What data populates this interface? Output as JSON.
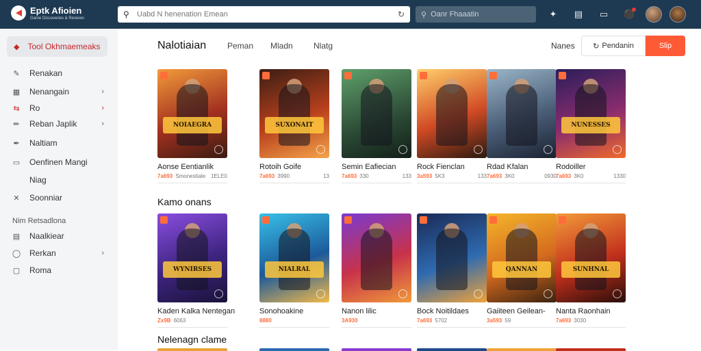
{
  "app": {
    "title": "Eptk Afioien",
    "subtitle": "Game Discoveries & Reviews"
  },
  "search": {
    "placeholder": "Uabd N henenation Emean"
  },
  "search2": {
    "placeholder": "Oanr Fhaaatin"
  },
  "sidebar": {
    "active": "Tool Okhmaemeaks",
    "items": [
      {
        "label": "Renakan",
        "icon": "pencil-icon",
        "chevron": false
      },
      {
        "label": "Nenangain",
        "icon": "grid-icon",
        "chevron": true
      },
      {
        "label": "Ro",
        "icon": "swap-icon",
        "chevron": true,
        "red": true
      },
      {
        "label": "Reban Japlik",
        "icon": "edit-icon",
        "chevron": true
      },
      {
        "label": "Naltiam",
        "icon": "pen-icon",
        "chevron": false
      },
      {
        "label": "Oenfinen Mangi",
        "icon": "monitor-icon",
        "chevron": false
      }
    ],
    "plain_item": "Niag",
    "item_x": {
      "label": "Soonniar",
      "icon": "close-icon"
    },
    "section_heading": "Nim Retsadlona",
    "section_items": [
      {
        "label": "Naalkiear",
        "icon": "card-icon",
        "chevron": false
      },
      {
        "label": "Rerkan",
        "icon": "help-icon",
        "chevron": true
      },
      {
        "label": "Roma",
        "icon": "box-icon",
        "chevron": false
      }
    ]
  },
  "main": {
    "title": "Nalotiaian",
    "tabs": [
      "Peman",
      "Mladn",
      "Nlatg"
    ],
    "filter_label": "Nanes",
    "btn_outline": "Pendanin",
    "btn_primary": "Slip",
    "sections": [
      "Kamo onans",
      "Nelenagn clame"
    ]
  },
  "row1": [
    {
      "name": "Aonse Eentianlik",
      "rating": "7a693",
      "meta": "Smonestiale",
      "count": "1ELE0",
      "banner": "NOIAEGRA",
      "bg": "linear-gradient(160deg,#f29b3b,#a3311f 55%,#3b1b12)"
    },
    {
      "name": "Rotoih Goife",
      "rating": "7a693",
      "meta": "3990",
      "count": "13",
      "banner": "SUXONAIT",
      "bg": "linear-gradient(160deg,#3a1e14,#b8401c 55%,#f4a34a)"
    },
    {
      "name": "Semin Eafiecian",
      "rating": "7a693",
      "meta": "330",
      "count": "133",
      "banner": "",
      "bg": "linear-gradient(160deg,#5fa06a,#2b4a35 60%,#121f18)"
    },
    {
      "name": "Rock Fienclan",
      "rating": "3a593",
      "meta": "5K3",
      "count": "133",
      "banner": "",
      "bg": "linear-gradient(160deg,#ffcf6a,#d14a24 55%,#2b1a10)"
    },
    {
      "name": "Rdad Kfalan",
      "rating": "7a693",
      "meta": "3K0",
      "count": "0930",
      "banner": "",
      "bg": "linear-gradient(160deg,#9bb6c8,#4a5e78 55%,#1a2130)"
    },
    {
      "name": "Rodoiller",
      "rating": "7a693",
      "meta": "3K0",
      "count": "1330",
      "banner": "NUNESSES",
      "bg": "linear-gradient(160deg,#2a1e5a,#8a2c6e 55%,#f06a2a)"
    }
  ],
  "row2": [
    {
      "name": "Kaden Kalka Nentegan",
      "rating": "Zx9B",
      "meta": "6063",
      "count": "",
      "banner": "WYNIRSES",
      "bg": "linear-gradient(160deg,#8a4ee0,#3e2480 55%,#1a1238)"
    },
    {
      "name": "Sonohoakine",
      "rating": "8880",
      "meta": "",
      "count": "",
      "banner": "NIALRAL",
      "bg": "linear-gradient(160deg,#38c0e8,#1c5a9a 55%,#f3b94a)"
    },
    {
      "name": "Nanon lilic",
      "rating": "3A930",
      "meta": "",
      "count": "",
      "banner": "",
      "bg": "linear-gradient(160deg,#7a3bd0,#c8324a 55%,#f09a3a)"
    },
    {
      "name": "Bock Noitildaes",
      "rating": "7a693",
      "meta": "5702",
      "count": "",
      "banner": "",
      "bg": "linear-gradient(160deg,#1b2a55,#2e6ab0 55%,#f0a23a)"
    },
    {
      "name": "Gaiiteen Geilean-",
      "rating": "3a593",
      "meta": "59",
      "count": "",
      "banner": "QANNAN",
      "bg": "linear-gradient(160deg,#f4b52a,#d46a1e 55%,#3a2210)"
    },
    {
      "name": "Nanta Raonhain",
      "rating": "7a693",
      "meta": "3030",
      "count": "",
      "banner": "SUNHNAL",
      "bg": "linear-gradient(160deg,#f29a3a,#c2301c 55%,#2a0e0a)"
    }
  ],
  "row3_colors": [
    "#e8a23a",
    "#2a6ab0",
    "#8a3bd0",
    "#1e4a8a",
    "#f0a23a",
    "#c2301c"
  ]
}
